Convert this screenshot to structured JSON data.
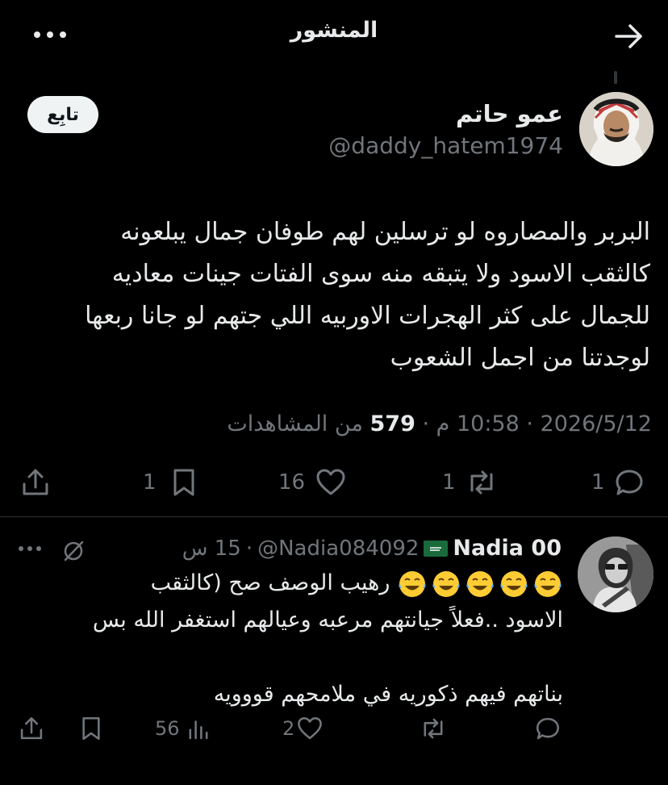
{
  "header": {
    "title": "المنشور"
  },
  "post": {
    "author_name": "عمو حاتم",
    "author_handle": "@daddy_hatem1974",
    "follow_label": "تابِع",
    "lines": [
      "البربر والمصاروه لو ترسلين لهم طوفان جمال يبلعونه",
      "كالثقب الاسود ولا يتبقه منه سوى الفتات جينات معاديه",
      "للجمال على كثر الهجرات الاوربيه اللي جتهم لو جانا ربعها",
      "لوجدتنا من اجمل الشعوب"
    ],
    "date": "2026/5/12",
    "time": "10:58 م",
    "views_count": "579",
    "views_label": "من المشاهدات",
    "stats": {
      "replies": "1",
      "reposts": "1",
      "likes": "16",
      "bookmarks": "1"
    }
  },
  "reply": {
    "name": "Nadia 00",
    "handle": "@Nadia084092",
    "time": "15 س",
    "line1_text": "رهيب الوصف صح (كالثقب",
    "line2": "الاسود ..فعلاً جيانتهم مرعبه وعيالهم استغفر الله بس",
    "line3": "بناتهم فيهم ذكوريه في ملامحهم قووويه",
    "stats": {
      "replies": "",
      "reposts": "",
      "likes": "2",
      "views": "56"
    }
  },
  "icons": {
    "back": "arrow-right-icon",
    "more": "more-horizontal-icon",
    "reply": "speech-bubble-icon",
    "repost": "repost-icon",
    "like": "heart-icon",
    "bookmark": "bookmark-icon",
    "share": "share-icon",
    "views": "bar-chart-icon",
    "grok": "grok-icon",
    "emoji": "face-with-tears-of-joy-emoji"
  },
  "colors": {
    "background": "#000000",
    "text_primary": "#e7e9ea",
    "text_secondary": "#71767b",
    "divider": "#2f3336",
    "follow_bg": "#eff3f4",
    "flag_green": "#1a6b3b"
  }
}
